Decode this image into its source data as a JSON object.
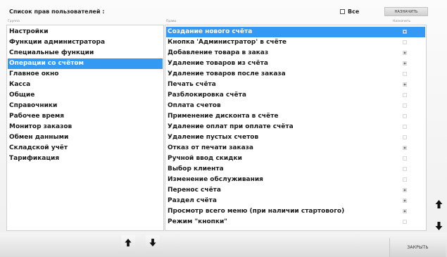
{
  "header": {
    "title": "Список прав пользователей :",
    "all_label": "Все",
    "all_checked": false,
    "assign_label": "НАЗНАЧИТЬ"
  },
  "columns": {
    "group": "Группа",
    "right": "Право",
    "assign": "Назначить"
  },
  "groups": [
    {
      "label": "Настройки",
      "selected": false
    },
    {
      "label": "Функции администратора",
      "selected": false
    },
    {
      "label": "Специальные функции",
      "selected": false
    },
    {
      "label": "Операции со счётом",
      "selected": true
    },
    {
      "label": "Главное окно",
      "selected": false
    },
    {
      "label": "Касса",
      "selected": false
    },
    {
      "label": "Общие",
      "selected": false
    },
    {
      "label": "Справочники",
      "selected": false
    },
    {
      "label": "Рабочее время",
      "selected": false
    },
    {
      "label": "Монитор заказов",
      "selected": false
    },
    {
      "label": "Обмен данными",
      "selected": false
    },
    {
      "label": "Складской учёт",
      "selected": false
    },
    {
      "label": "Тарификация",
      "selected": false
    }
  ],
  "rights": [
    {
      "label": "Создание нового счёта",
      "checked": true,
      "selected": true
    },
    {
      "label": "Кнопка 'Администратор' в счёте",
      "checked": false,
      "selected": false
    },
    {
      "label": "Добавление товара в заказ",
      "checked": true,
      "selected": false
    },
    {
      "label": "Удаление товаров из счёта",
      "checked": true,
      "selected": false
    },
    {
      "label": "Удаление товаров после заказа",
      "checked": false,
      "selected": false
    },
    {
      "label": "Печать счёта",
      "checked": true,
      "selected": false
    },
    {
      "label": "Разблокировка счёта",
      "checked": false,
      "selected": false
    },
    {
      "label": "Оплата счетов",
      "checked": false,
      "selected": false
    },
    {
      "label": "Применение дисконта в счёте",
      "checked": false,
      "selected": false
    },
    {
      "label": "Удаление оплат при оплате счёта",
      "checked": false,
      "selected": false
    },
    {
      "label": "Удаление пустых счетов",
      "checked": false,
      "selected": false
    },
    {
      "label": "Отказ от печати заказа",
      "checked": true,
      "selected": false
    },
    {
      "label": "Ручной ввод скидки",
      "checked": false,
      "selected": false
    },
    {
      "label": "Выбор клиента",
      "checked": false,
      "selected": false
    },
    {
      "label": "Изменение обслуживания",
      "checked": false,
      "selected": false
    },
    {
      "label": "Перенос счёта",
      "checked": true,
      "selected": false
    },
    {
      "label": "Раздел счёта",
      "checked": true,
      "selected": false
    },
    {
      "label": "Просмотр всего меню (при наличии стартового)",
      "checked": true,
      "selected": false
    },
    {
      "label": "Режим \"кнопки\"",
      "checked": false,
      "selected": false
    }
  ],
  "buttons": {
    "close_label": "ЗАКРЫТЬ",
    "up_icon": "arrow-up-icon",
    "down_icon": "arrow-down-icon"
  },
  "colors": {
    "selection": "#3399f3"
  }
}
